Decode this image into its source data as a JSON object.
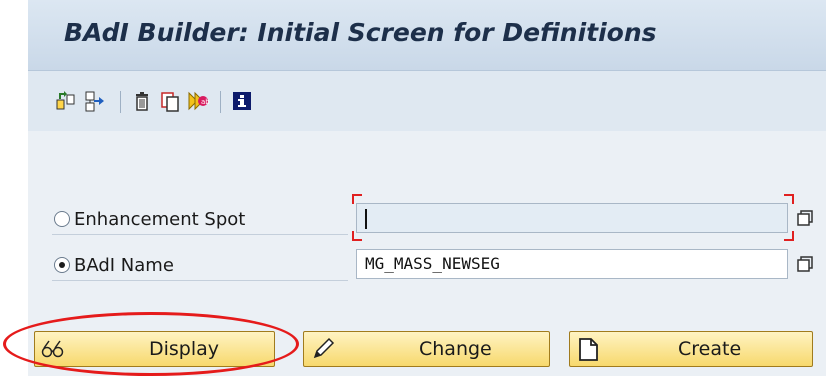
{
  "window": {
    "title": "BAdI Builder: Initial Screen for Definitions"
  },
  "toolbar": {
    "icons": [
      "other-object-icon",
      "where-used-icon",
      "delete-icon",
      "copy-icon",
      "rename-icon",
      "information-icon"
    ]
  },
  "form": {
    "options": [
      {
        "label": "Enhancement Spot",
        "selected": false,
        "value": ""
      },
      {
        "label": "BAdI Name",
        "selected": true,
        "value": "MG_MASS_NEWSEG"
      }
    ]
  },
  "actions": {
    "display_label": "Display",
    "change_label": "Change",
    "create_label": "Create"
  },
  "colors": {
    "button_bg": "#f7d96d",
    "highlight": "#e51b1b",
    "required_marker": "#e02020"
  }
}
